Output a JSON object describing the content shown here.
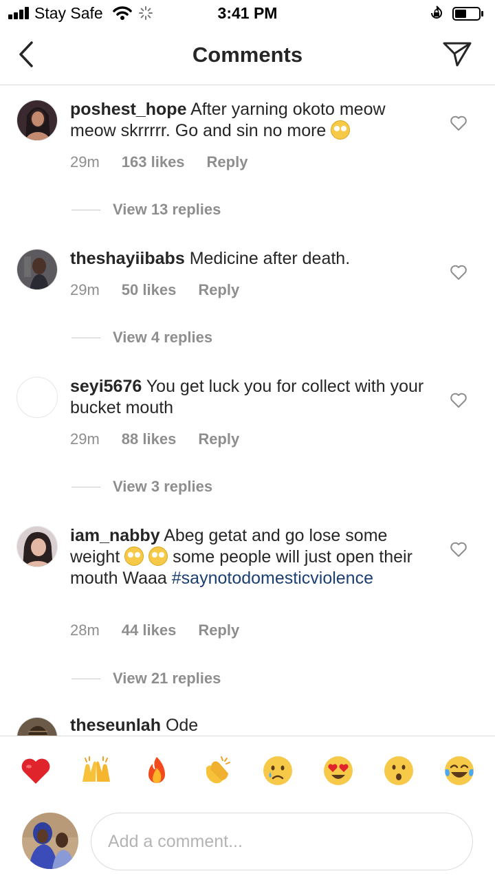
{
  "status_bar": {
    "carrier": "Stay Safe",
    "time": "3:41 PM"
  },
  "header": {
    "title": "Comments"
  },
  "comments": [
    {
      "username": "poshest_hope",
      "text": "After yarning okoto meow meow skrrrrr. Go and sin no more",
      "time": "29m",
      "likes": "163 likes",
      "reply": "Reply",
      "view_replies": "View 13 replies"
    },
    {
      "username": "theshayiibabs",
      "text": "Medicine after death.",
      "time": "29m",
      "likes": "50 likes",
      "reply": "Reply",
      "view_replies": "View 4 replies"
    },
    {
      "username": "seyi5676",
      "text": "You get luck you for collect with your bucket mouth",
      "time": "29m",
      "likes": "88 likes",
      "reply": "Reply",
      "view_replies": "View 3 replies"
    },
    {
      "username": "iam_nabby",
      "text_a": "Abeg getat and go lose some weight",
      "text_b": "some people will just open their mouth Waaa",
      "hashtag": "#saynotodomesticviolence",
      "time": "28m",
      "likes": "44 likes",
      "reply": "Reply",
      "view_replies": "View 21 replies"
    },
    {
      "username": "theseunlah",
      "text": "Ode"
    }
  ],
  "emoji_bar": [
    "red-heart",
    "raising-hands",
    "fire",
    "clapping-hands",
    "crying-face",
    "heart-eyes-face",
    "surprised-face",
    "tears-of-joy-face"
  ],
  "composer": {
    "placeholder": "Add a comment..."
  }
}
